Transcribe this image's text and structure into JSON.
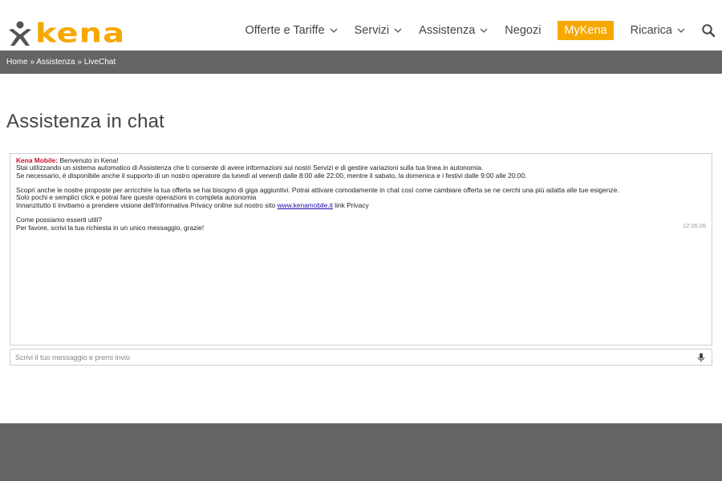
{
  "brand": {
    "name": "kena",
    "color": "#f5a800"
  },
  "nav": {
    "items": [
      {
        "label": "Offerte e Tariffe",
        "dropdown": true
      },
      {
        "label": "Servizi",
        "dropdown": true
      },
      {
        "label": "Assistenza",
        "dropdown": true
      },
      {
        "label": "Negozi",
        "dropdown": false
      },
      {
        "label": "MyKena",
        "dropdown": false
      },
      {
        "label": "Ricarica",
        "dropdown": true
      }
    ],
    "search_icon": "search-icon"
  },
  "breadcrumb": {
    "home": "Home",
    "separator": "»",
    "section": "Assistenza",
    "current": "LiveChat"
  },
  "page": {
    "title": "Assistenza in chat"
  },
  "chat": {
    "sender": "Kena Mobile:",
    "greeting": "Benvenuto in Kena!",
    "line1": "Stai utilizzando un sistema automatico di Assistenza che ti consente di avere informazioni sui nostri Servizi e di gestire variazioni sulla tua linea in autonomia.",
    "line2": "Se necessario, è disponibile anche il supporto di un nostro operatore da lunedì al venerdì dalle 8:00 alle 22:00, mentre il sabato, la domenica e i festivi dalle 9:00 alle 20:00.",
    "line3": "Scopri anche le nostre proposte per arricchire la tua offerta se hai bisogno di giga aggiuntivi. Potrai attivare comodamente in chat così come cambiare offerta se ne cerchi una più adatta alle tue esigenze.",
    "line4": "Solo pochi e semplici click e potrai fare queste operazioni in completa autonomia",
    "line5_before": "Innanzitutto ti invitiamo a prendere visione dell'Informativa Privacy online sul nostro sito",
    "link": "www.kenamobile.it",
    "line5_after": "link Privacy",
    "line6": "Come possiamo esserti utili?",
    "line7": "Per favore, scrivi la tua richiesta in un unico messaggio, grazie!",
    "timestamp": "12:26:26"
  },
  "input": {
    "placeholder": "Scrivi il tuo messaggio e premi invio",
    "value": ""
  }
}
